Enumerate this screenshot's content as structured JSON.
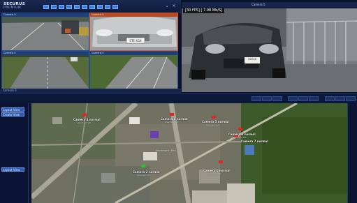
{
  "app": {
    "logo_line1": "SECURUS",
    "logo_line2": "PREMIUM"
  },
  "video_grid": {
    "tiles": [
      {
        "label": "Camera 3",
        "selected": false
      },
      {
        "label": "Camera 5",
        "selected": true
      },
      {
        "label": "Camera 4",
        "selected": false
      },
      {
        "label": "Camera 4",
        "selected": false
      }
    ],
    "plate_text": "STE 4CH",
    "footer_label": "Camera 3"
  },
  "big_video": {
    "title": "Camera 5",
    "fps_text": "[30 FPS] [ 7.98 Mb/S]",
    "plate_text": "XXXXX"
  },
  "left_panel": {
    "buttons": [
      "Layout View",
      "Create View",
      "Layout View"
    ]
  },
  "map": {
    "cameras": [
      {
        "name": "Camera 4 normal",
        "status": "Alarmed: 0/0",
        "color": "#e02626"
      },
      {
        "name": "Camera 6 normal",
        "status": "Alarmed: 0/0",
        "color": "#e02626"
      },
      {
        "name": "Camera 5 normal",
        "status": "Alarmed: 0/0",
        "color": "#e02626"
      },
      {
        "name": "Camera 3 normal",
        "status": "Alarmed: 0/0",
        "color": "#e02626"
      },
      {
        "name": "Camera 2 normal",
        "status": "Alarmed: 0/0",
        "color": "#e02626"
      },
      {
        "name": "Camera 1 normal",
        "status": "Alarmed: 0/0",
        "color": "#e02626"
      },
      {
        "name": "Camera 7 normal",
        "status": "Alarmed: 0/0",
        "color": "#e02626"
      }
    ],
    "labels": [
      "Mondawmin Mall",
      "Liberty Heights Ave"
    ],
    "active_marker_color": "#2bc42b"
  }
}
